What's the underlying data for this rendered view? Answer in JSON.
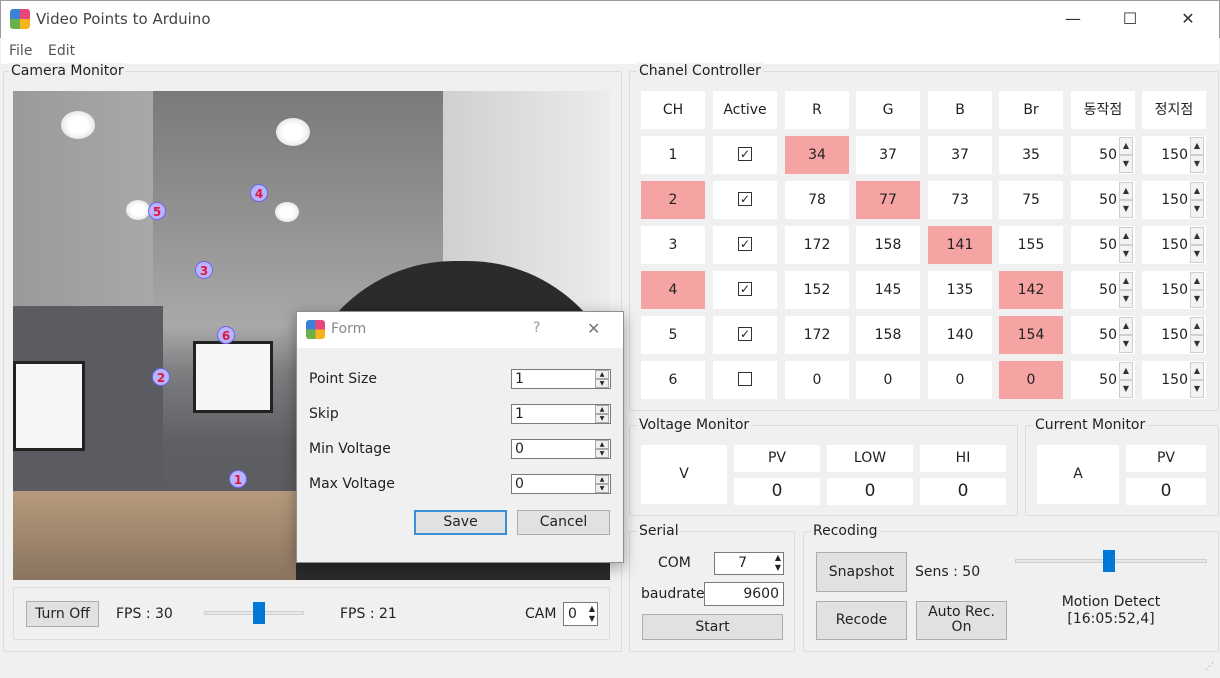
{
  "window": {
    "title": "Video Points to Arduino",
    "minimize": "—",
    "maximize": "☐",
    "close": "✕"
  },
  "menu": [
    "File",
    "Edit"
  ],
  "camera": {
    "legend": "Camera Monitor",
    "points": [
      "1",
      "2",
      "3",
      "4",
      "5",
      "6"
    ],
    "turn_off": "Turn Off",
    "fps_set": "FPS : 30",
    "fps_actual": "FPS : 21",
    "fps_slider": 0.55,
    "cam_label": "CAM",
    "cam_value": "0"
  },
  "channel": {
    "legend": "Chanel Controller",
    "headers": [
      "CH",
      "Active",
      "R",
      "G",
      "B",
      "Br",
      "동작점",
      "정지점"
    ],
    "rows": [
      {
        "ch": "1",
        "active": true,
        "r": "34",
        "g": "37",
        "b": "37",
        "br": "35",
        "op": "50",
        "stop": "150",
        "hl": [
          "r"
        ]
      },
      {
        "ch": "2",
        "active": true,
        "r": "78",
        "g": "77",
        "b": "73",
        "br": "75",
        "op": "50",
        "stop": "150",
        "hl": [
          "ch",
          "g"
        ]
      },
      {
        "ch": "3",
        "active": true,
        "r": "172",
        "g": "158",
        "b": "141",
        "br": "155",
        "op": "50",
        "stop": "150",
        "hl": [
          "b"
        ]
      },
      {
        "ch": "4",
        "active": true,
        "r": "152",
        "g": "145",
        "b": "135",
        "br": "142",
        "op": "50",
        "stop": "150",
        "hl": [
          "ch",
          "br"
        ]
      },
      {
        "ch": "5",
        "active": true,
        "r": "172",
        "g": "158",
        "b": "140",
        "br": "154",
        "op": "50",
        "stop": "150",
        "hl": [
          "br"
        ]
      },
      {
        "ch": "6",
        "active": false,
        "r": "0",
        "g": "0",
        "b": "0",
        "br": "0",
        "op": "50",
        "stop": "150",
        "hl": [
          "br"
        ]
      }
    ],
    "highlight_color": "#f5a3a3"
  },
  "voltage": {
    "legend": "Voltage Monitor",
    "unit": "V",
    "pv_label": "PV",
    "low_label": "LOW",
    "hi_label": "HI",
    "pv": "0",
    "low": "0",
    "hi": "0"
  },
  "current": {
    "legend": "Current Monitor",
    "unit": "A",
    "pv_label": "PV",
    "pv": "0"
  },
  "serial": {
    "legend": "Serial",
    "com_label": "COM",
    "com_value": "7",
    "baud_label": "baudrate",
    "baud_value": "9600",
    "start": "Start"
  },
  "recording": {
    "legend": "Recoding",
    "snapshot": "Snapshot",
    "sens": "Sens : 50",
    "sens_slider": 0.49,
    "recode": "Recode",
    "auto_rec": "Auto Rec.",
    "auto_rec_state": "On",
    "motion_label": "Motion Detect",
    "motion_time": "[16:05:52,4]"
  },
  "form": {
    "title": "Form",
    "help": "?",
    "close": "✕",
    "fields": [
      {
        "label": "Point Size",
        "value": "1"
      },
      {
        "label": "Skip",
        "value": "1"
      },
      {
        "label": "Min Voltage",
        "value": "0"
      },
      {
        "label": "Max Voltage",
        "value": "0"
      }
    ],
    "save": "Save",
    "cancel": "Cancel"
  }
}
